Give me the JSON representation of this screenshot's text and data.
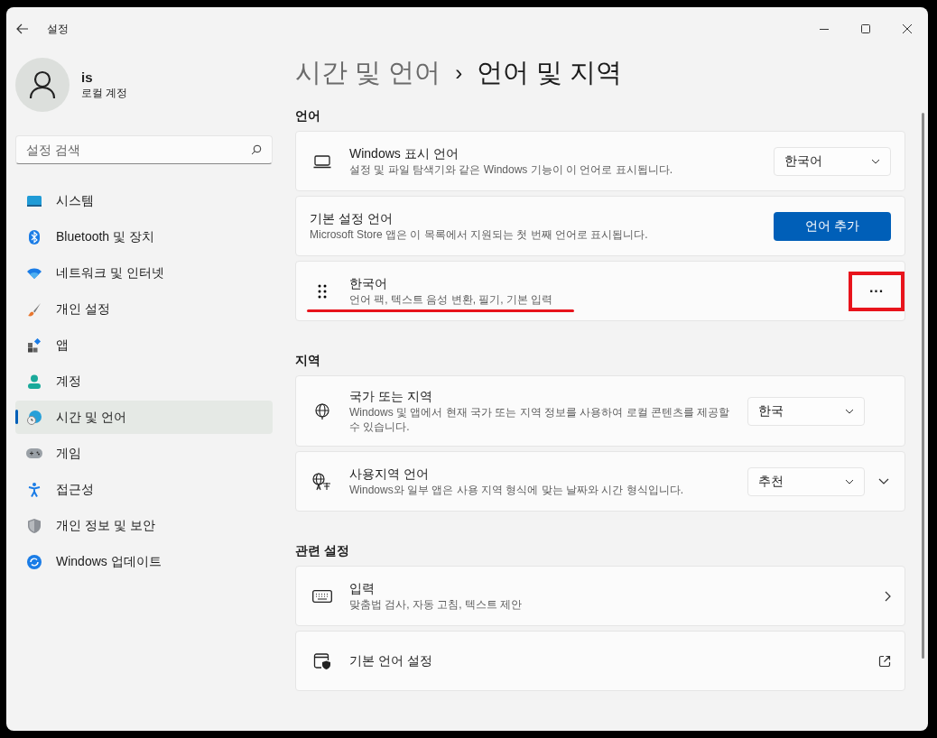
{
  "window": {
    "title": "설정"
  },
  "account": {
    "name": "is",
    "type": "로컬 계정"
  },
  "search": {
    "placeholder": "설정 검색"
  },
  "nav": [
    {
      "label": "시스템",
      "selected": false
    },
    {
      "label": "Bluetooth 및 장치",
      "selected": false
    },
    {
      "label": "네트워크 및 인터넷",
      "selected": false
    },
    {
      "label": "개인 설정",
      "selected": false
    },
    {
      "label": "앱",
      "selected": false
    },
    {
      "label": "계정",
      "selected": false
    },
    {
      "label": "시간 및 언어",
      "selected": true
    },
    {
      "label": "게임",
      "selected": false
    },
    {
      "label": "접근성",
      "selected": false
    },
    {
      "label": "개인 정보 및 보안",
      "selected": false
    },
    {
      "label": "Windows 업데이트",
      "selected": false
    }
  ],
  "breadcrumb": {
    "parent": "시간 및 언어",
    "separator": "›",
    "current": "언어 및 지역"
  },
  "sections": [
    {
      "heading": "언어",
      "cards": [
        {
          "kind": "dropdown",
          "title": "Windows 표시 언어",
          "description": "설정 및 파일 탐색기와 같은 Windows 기능이 이 언어로 표시됩니다.",
          "value": "한국어",
          "expandable": false
        },
        {
          "kind": "button",
          "title": "기본 설정 언어",
          "description": "Microsoft Store 앱은 이 목록에서 지원되는 첫 번째 언어로 표시됩니다.",
          "button": "언어 추가"
        },
        {
          "kind": "language",
          "title": "한국어",
          "description": "언어 팩, 텍스트 음성 변환, 필기, 기본 입력",
          "more": "···",
          "annotated": true
        }
      ]
    },
    {
      "heading": "지역",
      "cards": [
        {
          "kind": "dropdown",
          "title": "국가 또는 지역",
          "description": "Windows 및 앱에서 현재 국가 또는 지역 정보를 사용하여 로컬 콘텐츠를 제공할 수 있습니다.",
          "value": "한국",
          "expandable": false
        },
        {
          "kind": "dropdown",
          "title": "사용지역 언어",
          "description": "Windows와 일부 앱은 사용 지역 형식에 맞는 날짜와 시간 형식입니다.",
          "value": "추천",
          "expandable": true
        }
      ]
    },
    {
      "heading": "관련 설정",
      "cards": [
        {
          "kind": "link",
          "title": "입력",
          "description": "맞춤법 검사, 자동 고침, 텍스트 제안"
        },
        {
          "kind": "external",
          "title": "기본 언어 설정"
        }
      ]
    }
  ]
}
